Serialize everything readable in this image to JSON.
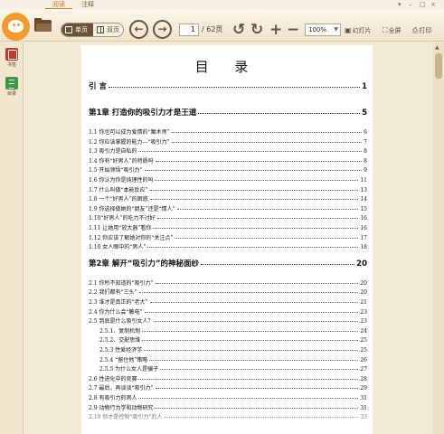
{
  "tabs": [
    {
      "label": "阅读",
      "active": true
    },
    {
      "label": "注释",
      "active": false
    }
  ],
  "toolbar": {
    "single_page": "单页",
    "double_page": "双页",
    "page_current": "1",
    "page_total": "/ 62页",
    "zoom": "100%",
    "slideshow": "幻灯片",
    "fullscreen": "全屏",
    "print": "打印"
  },
  "sidebar": [
    {
      "label": "书签"
    },
    {
      "label": "目录"
    }
  ],
  "document": {
    "title": "目 录",
    "entries": [
      {
        "text": "引 言",
        "page": "1",
        "level": "chapter"
      },
      {
        "text": "第1章  打造你的吸引力才是王道",
        "page": "5",
        "level": "chapter"
      },
      {
        "text": "1.1 你也可以成为爱情的“魔术师”",
        "page": "6",
        "level": "item"
      },
      {
        "text": "1.2 你应该掌握的能力—“吸引力”",
        "page": "7",
        "level": "item"
      },
      {
        "text": "1.3 吸引力是自私的",
        "page": "8",
        "level": "item"
      },
      {
        "text": "1.4 你有“好男人”的特质吗",
        "page": "8",
        "level": "item"
      },
      {
        "text": "1.5 开始领悟“吸引力”",
        "page": "9",
        "level": "item"
      },
      {
        "text": "1.6 你认为你是纯理性的吗",
        "page": "11",
        "level": "item"
      },
      {
        "text": "1.7 什么叫做“本能反应”",
        "page": "13",
        "level": "item"
      },
      {
        "text": "1.8 一个“好男人”的困惑",
        "page": "14",
        "level": "item"
      },
      {
        "text": "1.9 你选择做她的“朋友”还是“情人”",
        "page": "15",
        "level": "item"
      },
      {
        "text": "1.10“好男人”的吃力不讨好",
        "page": "16",
        "level": "item"
      },
      {
        "text": "1.11 让她用“放大器”看你",
        "page": "16",
        "level": "item"
      },
      {
        "text": "1.12 你应该了解她对你的“关注点”",
        "page": "17",
        "level": "item"
      },
      {
        "text": "1.10 女人眼中的“男人”",
        "page": "18",
        "level": "item"
      },
      {
        "text": "第2章  解开“吸引力”的神秘面纱",
        "page": "20",
        "level": "chapter"
      },
      {
        "text": "2.1 你所不知道的“吸引力”",
        "page": "20",
        "level": "item"
      },
      {
        "text": "2.2 我们都有“三头”",
        "page": "20",
        "level": "item"
      },
      {
        "text": "2.3 谁才是真正的“老大”",
        "page": "21",
        "level": "item"
      },
      {
        "text": "2.4 你为什么会“触电”",
        "page": "23",
        "level": "item"
      },
      {
        "text": "2.5 到底是什么吸引女人？",
        "page": "23",
        "level": "item"
      },
      {
        "text": "2.5.1、复制机制",
        "page": "24",
        "level": "sub"
      },
      {
        "text": "2.5.2、交配思维",
        "page": "25",
        "level": "sub"
      },
      {
        "text": "2.5.3   性爱经济学",
        "page": "25",
        "level": "sub"
      },
      {
        "text": "2.5.4 “留住他”策略",
        "page": "26",
        "level": "sub"
      },
      {
        "text": "2.5.5   为什么女人是骗子",
        "page": "27",
        "level": "sub"
      },
      {
        "text": "2.6 性进化中的竞赛",
        "page": "28",
        "level": "item"
      },
      {
        "text": "2.7 最后，再谈谈“吸引力”",
        "page": "29",
        "level": "item"
      },
      {
        "text": "2.8 有吸引力的男人",
        "page": "31",
        "level": "item"
      },
      {
        "text": "2.9 动物行为学和动物研究",
        "page": "31",
        "level": "item"
      },
      {
        "text": "2.10 你才是控制“吸引力”的人",
        "page": "33",
        "level": "item"
      }
    ]
  },
  "colors": {
    "accent": "#c77a23",
    "toolbar_brown": "#6b5238",
    "background": "#f3ead6"
  },
  "icons": [
    "app-logo-icon",
    "open-folder-icon",
    "single-page-icon",
    "double-page-icon",
    "prev-page-icon",
    "next-page-icon",
    "rotate-left-icon",
    "rotate-right-icon",
    "zoom-in-icon",
    "zoom-out-icon",
    "slideshow-icon",
    "fullscreen-icon",
    "print-icon",
    "bookmark-icon",
    "toc-icon"
  ]
}
